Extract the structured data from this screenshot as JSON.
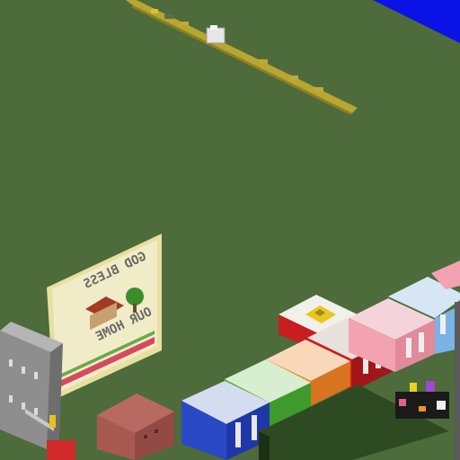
{
  "scene": {
    "view": "isometric voxel build world",
    "ground_color": "#4d6b3b",
    "water_color": "#0a12e6"
  },
  "sign": {
    "line1": "GOD BLESS",
    "line2": "OUR HOME",
    "mirrored": true
  },
  "blocks": [
    {
      "name": "white-block",
      "color": "#f1f1ea"
    },
    {
      "name": "red-block",
      "color": "#c81e22"
    },
    {
      "name": "pink-block",
      "color": "#f2a2b0"
    },
    {
      "name": "light-blue-block",
      "color": "#7bb3e6"
    },
    {
      "name": "blue-block",
      "color": "#2a49c6"
    },
    {
      "name": "green-block",
      "color": "#4fb33a"
    },
    {
      "name": "orange-block",
      "color": "#f08a2a"
    },
    {
      "name": "dark-green-slab",
      "color": "#243a1c"
    },
    {
      "name": "clay-block",
      "color": "#b0635b"
    },
    {
      "name": "gray-building",
      "color": "#8e8e8e"
    }
  ]
}
